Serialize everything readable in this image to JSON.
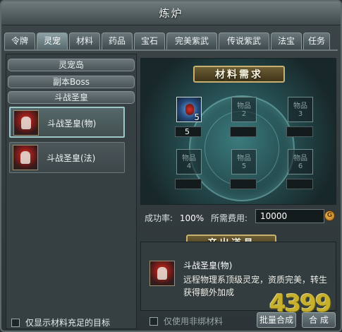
{
  "window": {
    "title": "炼炉"
  },
  "tabs": [
    {
      "label": "令牌"
    },
    {
      "label": "灵宠"
    },
    {
      "label": "材料"
    },
    {
      "label": "药品"
    },
    {
      "label": "宝石"
    },
    {
      "label": "完美紫武"
    },
    {
      "label": "传说紫武"
    },
    {
      "label": "法宝"
    },
    {
      "label": "任务"
    }
  ],
  "active_tab": "灵宠",
  "left": {
    "categories": [
      {
        "label": "灵宠岛"
      },
      {
        "label": "副本Boss"
      },
      {
        "label": "斗战圣皇"
      }
    ],
    "items": [
      {
        "label": "斗战圣皇(物)",
        "icon": "pet-warrior-icon",
        "selected": true
      },
      {
        "label": "斗战圣皇(法)",
        "icon": "pet-warrior-icon",
        "selected": false
      }
    ],
    "filter_label": "仅显示材料充足的目标"
  },
  "materials": {
    "title": "材料需求",
    "slots": [
      {
        "label": "",
        "count": "5",
        "quantity": "5",
        "icon": "pet-egg-icon"
      },
      {
        "label": "物品\n2",
        "count": "",
        "quantity": ""
      },
      {
        "label": "物品\n3",
        "count": "",
        "quantity": ""
      },
      {
        "label": "物品\n4",
        "count": "",
        "quantity": ""
      },
      {
        "label": "物品\n5",
        "count": "",
        "quantity": ""
      },
      {
        "label": "物品\n6",
        "count": "",
        "quantity": ""
      }
    ]
  },
  "stats": {
    "success_rate_label": "成功率:",
    "success_rate": "100%",
    "fee_label": "所需费用:",
    "fee": "10000",
    "coin_symbol": "G"
  },
  "output": {
    "title": "产出道具",
    "name": "斗战圣皇(物)",
    "description": "远程物理系顶级灵宠，资质完美，转生获得额外加成",
    "icon": "pet-warrior-icon"
  },
  "footer": {
    "unbound_only_label": "仅使用非绑材料",
    "batch_button": "批量合成",
    "combine_button": "合 成"
  },
  "watermark": "4399",
  "colors": {
    "accent": "#c8b070",
    "panel": "#333c3f",
    "highlight": "#9ec7c8"
  }
}
